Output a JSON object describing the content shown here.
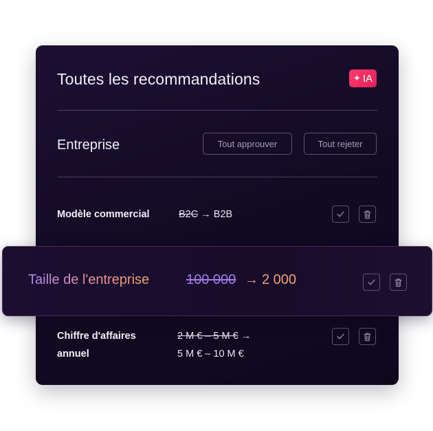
{
  "panel": {
    "title": "Toutes les recommandations",
    "ai_badge": {
      "icon": "sparkle-icon",
      "label": "IA"
    }
  },
  "section": {
    "title": "Entreprise",
    "approve_all_label": "Tout approuver",
    "reject_all_label": "Tout rejeter"
  },
  "rows": [
    {
      "label": "Modèle commercial",
      "old_value": "B2C",
      "arrow": "→",
      "new_value": "B2B",
      "actions": [
        "check-icon",
        "trash-icon"
      ]
    },
    {
      "label": "Taille de l'entreprise",
      "old_value": "100 000",
      "arrow": "→",
      "new_value": "2 000",
      "actions": [
        "check-icon",
        "trash-icon"
      ]
    },
    {
      "label_line1": "Chiffre d'affaires",
      "label_line2": "annuel",
      "old_value": "2 M € – 5 M €",
      "arrow": "→",
      "new_value": "5 M € – 10 M €",
      "actions": [
        "check-icon",
        "trash-icon"
      ]
    }
  ],
  "colors": {
    "panel_bg": "#140b27",
    "badge": "#ec2d63",
    "highlight_gradient_start": "#a88cf0",
    "highlight_gradient_end": "#f4a06e"
  }
}
